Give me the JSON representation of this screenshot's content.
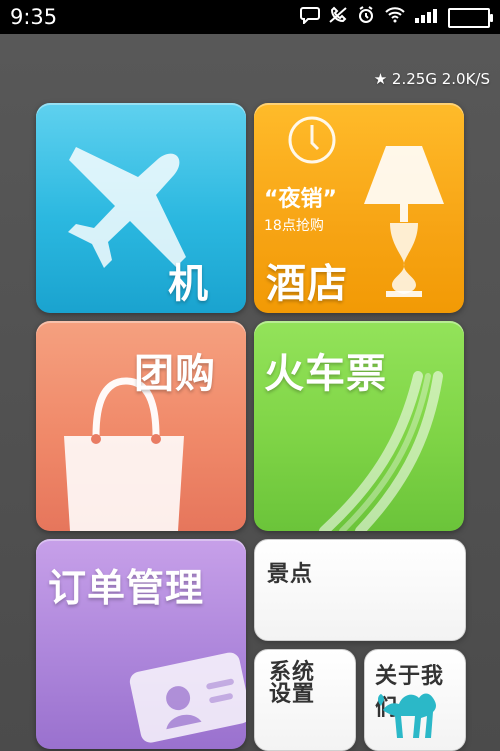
{
  "statusbar": {
    "time": "9:35"
  },
  "overlay": {
    "text": "★ 2.25G  2.0K/S"
  },
  "tiles": {
    "flight": {
      "label": "机票"
    },
    "hotel": {
      "label": "酒店",
      "badge_title": "“夜销”",
      "badge_sub": "18点抢购"
    },
    "group": {
      "label": "团购"
    },
    "train": {
      "label": "火车票"
    },
    "order": {
      "label": "订单管理"
    },
    "scenic": {
      "label": "景点"
    },
    "settings": {
      "label": "系统\n设置"
    },
    "about": {
      "label": "关于我们"
    }
  },
  "icons": {
    "status": [
      "chat-bubble-icon",
      "phone-mute-icon",
      "alarm-icon",
      "wifi-icon",
      "signal-icon",
      "battery-icon"
    ],
    "tile_icons": {
      "flight": "airplane-icon",
      "hotel": "lamp-icon",
      "group": "shopping-bag-icon",
      "train": "rail-tracks-icon",
      "order": "id-card-icon",
      "about": "camel-icon"
    }
  },
  "colors": {
    "flight": "#2bb8e0",
    "hotel": "#f7a414",
    "group": "#f08969",
    "train": "#7fd446",
    "order": "#ad86db",
    "camel": "#2bb8c8"
  }
}
